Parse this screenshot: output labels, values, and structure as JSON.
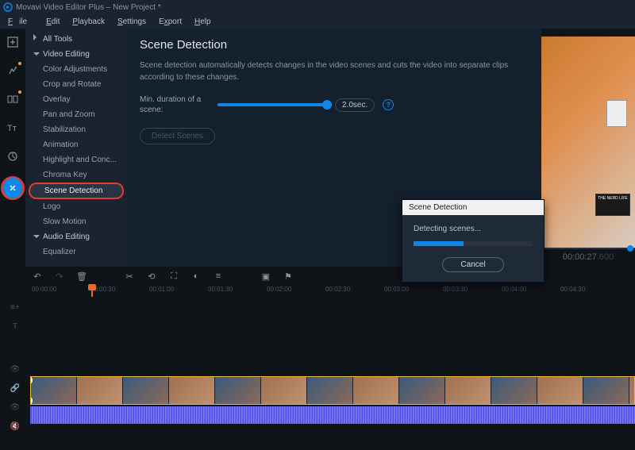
{
  "titlebar": {
    "title": "Movavi Video Editor Plus – New Project *"
  },
  "menu": {
    "file": "File",
    "edit": "Edit",
    "playback": "Playback",
    "settings": "Settings",
    "export": "Export",
    "help": "Help"
  },
  "leftstrip": [
    "add-media",
    "effects",
    "transitions",
    "titles",
    "stickers",
    "more-tools"
  ],
  "sidebar": {
    "all_tools": "All Tools",
    "video_editing": "Video Editing",
    "items": [
      "Color Adjustments",
      "Crop and Rotate",
      "Overlay",
      "Pan and Zoom",
      "Stabilization",
      "Animation",
      "Highlight and Conc...",
      "Chroma Key",
      "Scene Detection",
      "Logo",
      "Slow Motion"
    ],
    "audio_editing": "Audio Editing",
    "audio_items": [
      "Equalizer"
    ],
    "selected_index": 8
  },
  "panel": {
    "title": "Scene Detection",
    "description": "Scene detection automatically detects changes in the video scenes and cuts the video into separate clips according to these changes.",
    "min_dur_label": "Min. duration of a scene:",
    "min_dur_value": "2.0sec.",
    "detect_button": "Detect Scenes"
  },
  "dialog": {
    "title": "Scene Detection",
    "status": "Detecting scenes...",
    "progress_pct": 42,
    "cancel": "Cancel"
  },
  "preview": {
    "sign_text": "THE NERD LIFE",
    "timecode": "00:00:27",
    "timecode_ms": ".600"
  },
  "ruler": [
    "00:00:00",
    "00:00:30",
    "00:01:00",
    "00:01:30",
    "00:02:00",
    "00:02:30",
    "00:03:00",
    "00:03:30",
    "00:04:00",
    "00:04:30"
  ]
}
